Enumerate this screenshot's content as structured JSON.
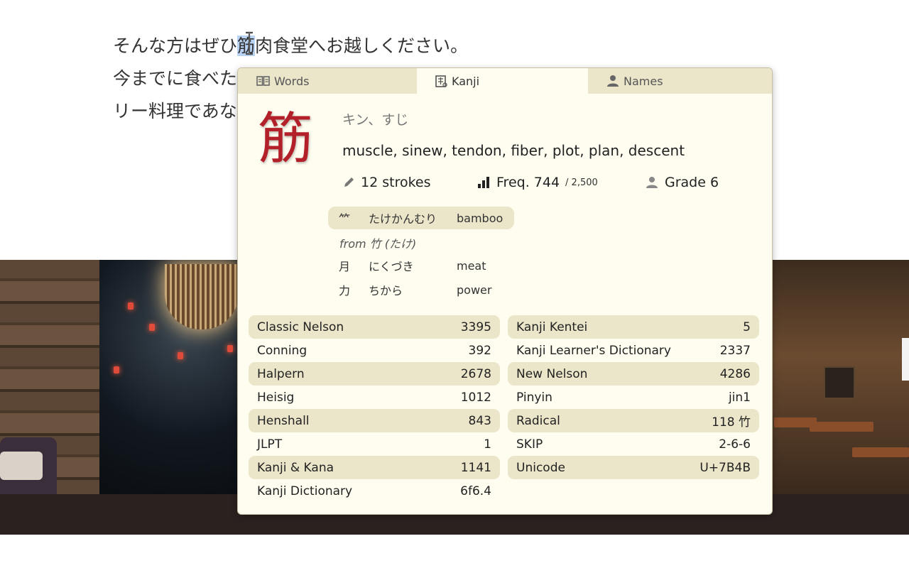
{
  "page": {
    "lines": [
      {
        "before": "そんな方はぜひ",
        "highlight": "筋",
        "after": "肉食堂へお越しください。"
      },
      {
        "before": "今までに食べたこ",
        "highlight": "",
        "after": ""
      },
      {
        "before": "リー料理であな",
        "highlight": "",
        "after": ""
      }
    ]
  },
  "popup": {
    "tabs": [
      {
        "label": "Words",
        "icon": "book-icon",
        "active": false
      },
      {
        "label": "Kanji",
        "icon": "kanji-icon",
        "active": true
      },
      {
        "label": "Names",
        "icon": "person-icon",
        "active": false
      }
    ],
    "kanji": "筋",
    "readings": "キン、すじ",
    "meanings": "muscle, sinew, tendon, fiber, plot, plan, descent",
    "strokes": "12 strokes",
    "frequency": {
      "label": "Freq. 744",
      "total": "/ 2,500"
    },
    "grade": "Grade 6",
    "components": {
      "main": {
        "char": "⺮",
        "reading": "たけかんむり",
        "meaning": "bamboo"
      },
      "from": "from 竹 (たけ)",
      "others": [
        {
          "char": "月",
          "reading": "にくづき",
          "meaning": "meat"
        },
        {
          "char": "力",
          "reading": "ちから",
          "meaning": "power"
        }
      ]
    },
    "references_left": [
      {
        "name": "Classic Nelson",
        "value": "3395"
      },
      {
        "name": "Conning",
        "value": "392"
      },
      {
        "name": "Halpern",
        "value": "2678"
      },
      {
        "name": "Heisig",
        "value": "1012"
      },
      {
        "name": "Henshall",
        "value": "843"
      },
      {
        "name": "JLPT",
        "value": "1"
      },
      {
        "name": "Kanji & Kana",
        "value": "1141"
      },
      {
        "name": "Kanji Dictionary",
        "value": "6f6.4"
      }
    ],
    "references_right": [
      {
        "name": "Kanji Kentei",
        "value": "5"
      },
      {
        "name": "Kanji Learner's Dictionary",
        "value": "2337"
      },
      {
        "name": "New Nelson",
        "value": "4286"
      },
      {
        "name": "Pinyin",
        "value": "jin1"
      },
      {
        "name": "Radical",
        "value": "118 竹"
      },
      {
        "name": "SKIP",
        "value": "2-6-6"
      },
      {
        "name": "Unicode",
        "value": "U+7B4B"
      }
    ]
  },
  "colors": {
    "kanji": "#b3202a",
    "popup_bg": "#fffdf0",
    "tab_bar": "#ebe5c9",
    "selection": "#b9d3f5"
  }
}
